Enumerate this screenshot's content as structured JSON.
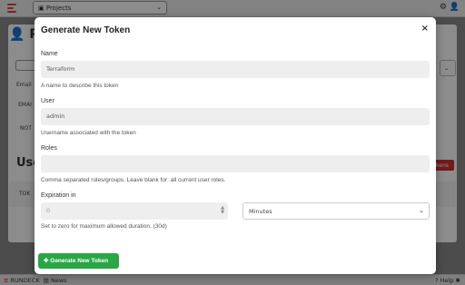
{
  "topbar": {
    "project_select": "Projects",
    "settings_icon": "gear-icon",
    "user_icon": "user-icon"
  },
  "background": {
    "title": "Pr",
    "users_heading": "Use",
    "red_button": "kens",
    "labels": [
      "Email",
      "EMAI",
      "NOT",
      "TOK"
    ]
  },
  "modal": {
    "title": "Generate New Token",
    "close_label": "×",
    "name": {
      "label": "Name",
      "value": "Terraform",
      "help": "A name to describe this token"
    },
    "user": {
      "label": "User",
      "value": "admin",
      "help": "Username associated with the token"
    },
    "roles": {
      "label": "Roles",
      "value": "",
      "help": "Comma separated roles/groups. Leave blank for: all current user roles."
    },
    "expiration": {
      "label": "Expiration in",
      "value": "0",
      "unit": "Minutes",
      "help": "Set to zero for maximum allowed duration. (30d)"
    },
    "submit_label": "Generate New Token"
  },
  "footer": {
    "brand": "RUNDECK",
    "news": "News",
    "help": "Help"
  },
  "colors": {
    "accent_green": "#28a745",
    "brand_red": "#e53e3e",
    "danger_red": "#d62f2f"
  }
}
